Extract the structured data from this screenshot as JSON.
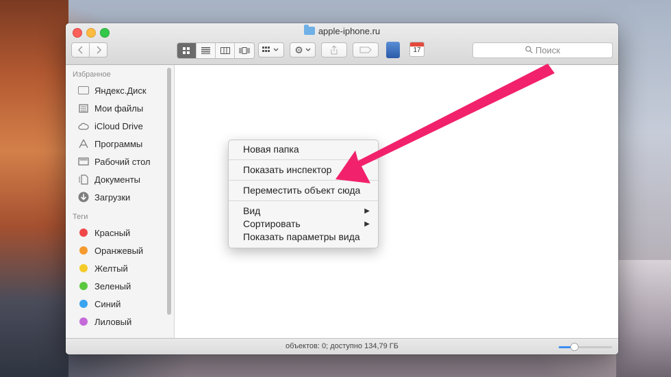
{
  "window": {
    "title": "apple-iphone.ru"
  },
  "toolbar": {
    "back_icon": "chevron-left-icon",
    "forward_icon": "chevron-right-icon",
    "search_placeholder": "Поиск"
  },
  "sidebar": {
    "favorites_header": "Избранное",
    "favorites": [
      {
        "label": "Яндекс.Диск",
        "icon": "folder-icon"
      },
      {
        "label": "Мои файлы",
        "icon": "files-icon"
      },
      {
        "label": "iCloud Drive",
        "icon": "cloud-icon"
      },
      {
        "label": "Программы",
        "icon": "applications-icon"
      },
      {
        "label": "Рабочий стол",
        "icon": "desktop-icon"
      },
      {
        "label": "Документы",
        "icon": "documents-icon"
      },
      {
        "label": "Загрузки",
        "icon": "downloads-icon"
      }
    ],
    "tags_header": "Теги",
    "tags": [
      {
        "label": "Красный",
        "color": "#f04848"
      },
      {
        "label": "Оранжевый",
        "color": "#f59a2f"
      },
      {
        "label": "Желтый",
        "color": "#f5cb2a"
      },
      {
        "label": "Зеленый",
        "color": "#5ac83f"
      },
      {
        "label": "Синий",
        "color": "#3ba4f0"
      },
      {
        "label": "Лиловый",
        "color": "#c56ad9"
      }
    ]
  },
  "context_menu": {
    "items": [
      "Новая папка",
      "Показать инспектор",
      "Переместить объект сюда",
      "Вид",
      "Сортировать",
      "Показать параметры вида"
    ]
  },
  "status": {
    "text": "объектов: 0; доступно 134,79 ГБ",
    "zoom_level": 0.25
  },
  "colors": {
    "accent": "#3b8ef0",
    "arrow": "#f2216b"
  }
}
